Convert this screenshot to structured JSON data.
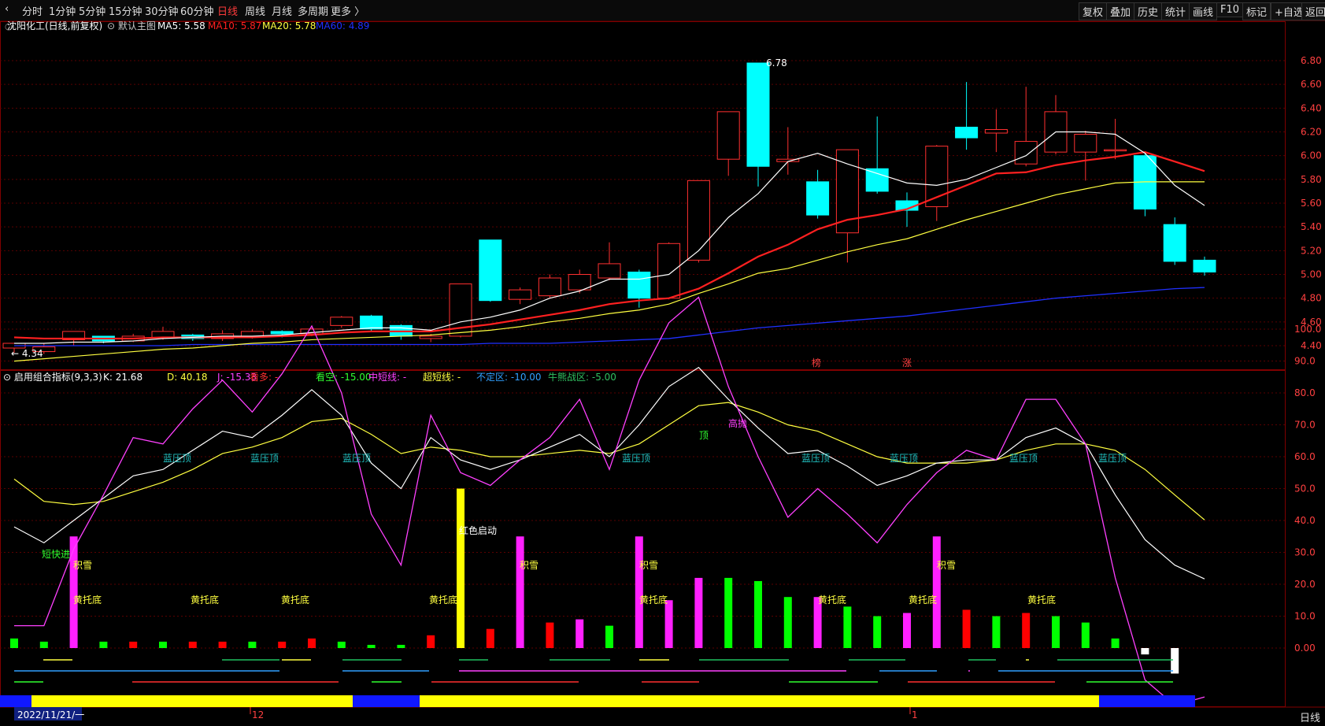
{
  "toolbar": {
    "periods": [
      "分时",
      "1分钟",
      "5分钟",
      "15分钟",
      "30分钟",
      "60分钟",
      "日线",
      "周线",
      "月线",
      "多周期",
      "更多 〉"
    ],
    "active_index": 6,
    "right_buttons": [
      "复权",
      "叠加",
      "历史",
      "统计",
      "画线",
      "F10",
      "标记",
      "+自选",
      "返回"
    ]
  },
  "main_panel": {
    "title": "沈阳化工(日线,前复权)",
    "indicator": "默认主图",
    "ma_labels": [
      {
        "text": "MA5: 5.58",
        "color": "#ffffff"
      },
      {
        "text": "MA10: 5.87",
        "color": "#ff2020"
      },
      {
        "text": "MA20: 5.78",
        "color": "#ffff40"
      },
      {
        "text": "MA60: 4.89",
        "color": "#2030ff"
      }
    ],
    "price_ticks": [
      "6.80",
      "6.60",
      "6.40",
      "6.20",
      "6.00",
      "5.80",
      "5.60",
      "5.40",
      "5.20",
      "5.00",
      "4.80",
      "4.60",
      "4.40"
    ],
    "high_label": "6.78",
    "low_label": "4.34",
    "markers": [
      "榜",
      "涨"
    ]
  },
  "sub_panel": {
    "title": "启用组合指标(9,3,3)",
    "legend": [
      {
        "text": "K: 21.68",
        "color": "#ffffff"
      },
      {
        "text": "D: 40.18",
        "color": "#ffff40"
      },
      {
        "text": "J: -15.33",
        "color": "#ff40ff"
      },
      {
        "text": "看多: -",
        "color": "#ff3030"
      },
      {
        "text": "看空: -15.00",
        "color": "#30ff30"
      },
      {
        "text": "中短线: -",
        "color": "#ff40ff"
      },
      {
        "text": "超短线: -",
        "color": "#ffff40"
      },
      {
        "text": "不定区: -10.00",
        "color": "#30a0ff"
      },
      {
        "text": "牛熊战区: -5.00",
        "color": "#30c060"
      }
    ],
    "y_ticks": [
      "100.0",
      "90.0",
      "80.0",
      "70.0",
      "60.0",
      "50.0",
      "40.0",
      "30.0",
      "20.0",
      "10.0",
      "0.00"
    ],
    "annotations": {
      "lanya": "蓝压顶",
      "huangtuo": "黄托底",
      "jixue": "积雪",
      "duankuaijin": "短快进",
      "hongse": "红色启动",
      "ding": "顶",
      "gaopao": "高抛"
    }
  },
  "bottom_axis": {
    "date_label": "2022/11/21/一",
    "month_labels": [
      "12",
      "1"
    ],
    "period": "日线"
  },
  "chart_data": {
    "type": "candlestick",
    "candles": [
      [
        4.38,
        4.42,
        4.38,
        4.34
      ],
      [
        4.35,
        4.39,
        4.42,
        4.33
      ],
      [
        4.45,
        4.52,
        4.52,
        4.4
      ],
      [
        4.48,
        4.44,
        4.48,
        4.42
      ],
      [
        4.44,
        4.48,
        4.5,
        4.43
      ],
      [
        4.47,
        4.52,
        4.56,
        4.45
      ],
      [
        4.49,
        4.46,
        4.5,
        4.44
      ],
      [
        4.46,
        4.5,
        4.53,
        4.44
      ],
      [
        4.48,
        4.52,
        4.54,
        4.46
      ],
      [
        4.52,
        4.5,
        4.53,
        4.47
      ],
      [
        4.5,
        4.54,
        4.55,
        4.48
      ],
      [
        4.57,
        4.64,
        4.65,
        4.55
      ],
      [
        4.65,
        4.54,
        4.66,
        4.52
      ],
      [
        4.57,
        4.48,
        4.58,
        4.45
      ],
      [
        4.46,
        4.48,
        4.5,
        4.43
      ],
      [
        4.48,
        4.92,
        4.92,
        4.47
      ],
      [
        5.29,
        4.78,
        5.29,
        4.77
      ],
      [
        4.79,
        4.87,
        4.89,
        4.75
      ],
      [
        4.82,
        4.97,
        5.0,
        4.8
      ],
      [
        4.87,
        5.0,
        5.04,
        4.84
      ],
      [
        4.97,
        5.09,
        5.27,
        4.95
      ],
      [
        5.02,
        4.8,
        5.04,
        4.72
      ],
      [
        4.8,
        5.26,
        5.27,
        4.79
      ],
      [
        5.12,
        5.79,
        5.79,
        5.1
      ],
      [
        5.97,
        6.37,
        6.37,
        5.83
      ],
      [
        6.78,
        5.91,
        6.78,
        5.74
      ],
      [
        5.95,
        5.97,
        6.24,
        5.84
      ],
      [
        5.78,
        5.5,
        5.88,
        5.47
      ],
      [
        5.35,
        6.05,
        6.05,
        5.1
      ],
      [
        5.89,
        5.7,
        6.33,
        5.68
      ],
      [
        5.62,
        5.54,
        5.69,
        5.4
      ],
      [
        5.57,
        6.08,
        6.09,
        5.45
      ],
      [
        6.24,
        6.15,
        6.62,
        6.05
      ],
      [
        6.19,
        6.22,
        6.39,
        6.03
      ],
      [
        5.93,
        6.12,
        6.58,
        5.91
      ],
      [
        6.03,
        6.37,
        6.51,
        6.01
      ],
      [
        6.03,
        6.18,
        6.21,
        5.79
      ],
      [
        6.04,
        6.05,
        6.31,
        5.97
      ],
      [
        6.0,
        5.55,
        6.02,
        5.49
      ],
      [
        5.42,
        5.11,
        5.48,
        5.08
      ],
      [
        5.12,
        5.02,
        5.15,
        4.99
      ]
    ],
    "ma5": [
      4.42,
      4.42,
      4.43,
      4.43,
      4.44,
      4.46,
      4.47,
      4.48,
      4.48,
      4.49,
      4.51,
      4.53,
      4.55,
      4.55,
      4.53,
      4.6,
      4.64,
      4.7,
      4.8,
      4.86,
      4.96,
      4.96,
      5.0,
      5.2,
      5.48,
      5.68,
      5.95,
      6.02,
      5.93,
      5.85,
      5.77,
      5.75,
      5.8,
      5.9,
      6.0,
      6.2,
      6.2,
      6.18,
      6.02,
      5.75,
      5.58
    ],
    "ma10": [
      4.47,
      4.46,
      4.46,
      4.46,
      4.46,
      4.47,
      4.47,
      4.47,
      4.47,
      4.48,
      4.49,
      4.51,
      4.52,
      4.52,
      4.52,
      4.55,
      4.58,
      4.62,
      4.66,
      4.7,
      4.75,
      4.78,
      4.8,
      4.88,
      5.01,
      5.15,
      5.25,
      5.38,
      5.46,
      5.5,
      5.55,
      5.65,
      5.75,
      5.85,
      5.86,
      5.92,
      5.96,
      5.99,
      6.03,
      5.95,
      5.87
    ],
    "ma20": [
      4.27,
      4.29,
      4.31,
      4.33,
      4.35,
      4.37,
      4.38,
      4.4,
      4.42,
      4.43,
      4.45,
      4.46,
      4.47,
      4.48,
      4.49,
      4.51,
      4.53,
      4.56,
      4.6,
      4.63,
      4.67,
      4.7,
      4.75,
      4.84,
      4.92,
      5.01,
      5.05,
      5.12,
      5.19,
      5.25,
      5.3,
      5.38,
      5.46,
      5.53,
      5.6,
      5.67,
      5.72,
      5.77,
      5.78,
      5.78,
      5.78
    ],
    "ma60": [
      4.4,
      4.4,
      4.4,
      4.4,
      4.4,
      4.4,
      4.41,
      4.41,
      4.41,
      4.41,
      4.41,
      4.41,
      4.41,
      4.41,
      4.41,
      4.41,
      4.42,
      4.42,
      4.42,
      4.43,
      4.44,
      4.45,
      4.46,
      4.49,
      4.52,
      4.55,
      4.57,
      4.59,
      4.61,
      4.63,
      4.65,
      4.68,
      4.71,
      4.74,
      4.77,
      4.8,
      4.82,
      4.84,
      4.86,
      4.88,
      4.89
    ],
    "k": [
      38,
      33,
      40,
      47,
      54,
      56,
      62,
      68,
      66,
      73,
      81,
      73,
      58,
      50,
      66,
      59,
      56,
      59,
      63,
      67,
      60,
      70,
      82,
      88,
      78,
      69,
      61,
      62,
      57,
      51,
      54,
      58,
      59,
      59,
      66,
      69,
      64,
      48,
      34,
      26,
      21.68
    ],
    "d": [
      53,
      46,
      45,
      46,
      49,
      52,
      56,
      61,
      63,
      66,
      71,
      72,
      67,
      61,
      63,
      62,
      60,
      60,
      61,
      62,
      61,
      64,
      70,
      76,
      77,
      74,
      70,
      68,
      64,
      60,
      58,
      58,
      58,
      59,
      62,
      64,
      64,
      62,
      56,
      48,
      40.18
    ],
    "j": [
      7,
      7,
      31,
      48,
      66,
      64,
      75,
      84,
      74,
      86,
      101,
      80,
      42,
      26,
      73,
      55,
      51,
      59,
      66,
      78,
      56,
      84,
      102,
      110,
      82,
      60,
      41,
      50,
      42,
      33,
      45,
      55,
      62,
      59,
      78,
      78,
      64,
      22,
      -10,
      -18,
      -15.33
    ],
    "histogram": [
      [
        3,
        "#00ff00"
      ],
      [
        2,
        "#00ff00"
      ],
      [
        35,
        "#ff20ff"
      ],
      [
        2,
        "#00ff00"
      ],
      [
        2,
        "#ff0000"
      ],
      [
        2,
        "#00ff00"
      ],
      [
        2,
        "#ff0000"
      ],
      [
        2,
        "#ff0000"
      ],
      [
        2,
        "#00ff00"
      ],
      [
        2,
        "#ff0000"
      ],
      [
        3,
        "#ff0000"
      ],
      [
        2,
        "#00ff00"
      ],
      [
        1,
        "#00ff00"
      ],
      [
        1,
        "#00ff00"
      ],
      [
        4,
        "#ff0000"
      ],
      [
        50,
        "#ffff00"
      ],
      [
        6,
        "#ff0000"
      ],
      [
        35,
        "#ff20ff"
      ],
      [
        8,
        "#ff0000"
      ],
      [
        9,
        "#ff20ff"
      ],
      [
        7,
        "#00ff00"
      ],
      [
        35,
        "#ff20ff"
      ],
      [
        15,
        "#ff20ff"
      ],
      [
        22,
        "#ff20ff"
      ],
      [
        22,
        "#00ff00"
      ],
      [
        21,
        "#00ff00"
      ],
      [
        16,
        "#00ff00"
      ],
      [
        16,
        "#ff20ff"
      ],
      [
        13,
        "#00ff00"
      ],
      [
        10,
        "#00ff00"
      ],
      [
        11,
        "#ff20ff"
      ],
      [
        35,
        "#ff20ff"
      ],
      [
        12,
        "#ff0000"
      ],
      [
        10,
        "#00ff00"
      ],
      [
        11,
        "#ff0000"
      ],
      [
        10,
        "#00ff00"
      ],
      [
        8,
        "#00ff00"
      ],
      [
        3,
        "#00ff00"
      ],
      [
        -2,
        "#ffffff"
      ],
      [
        -8,
        "#ffffff"
      ]
    ]
  }
}
